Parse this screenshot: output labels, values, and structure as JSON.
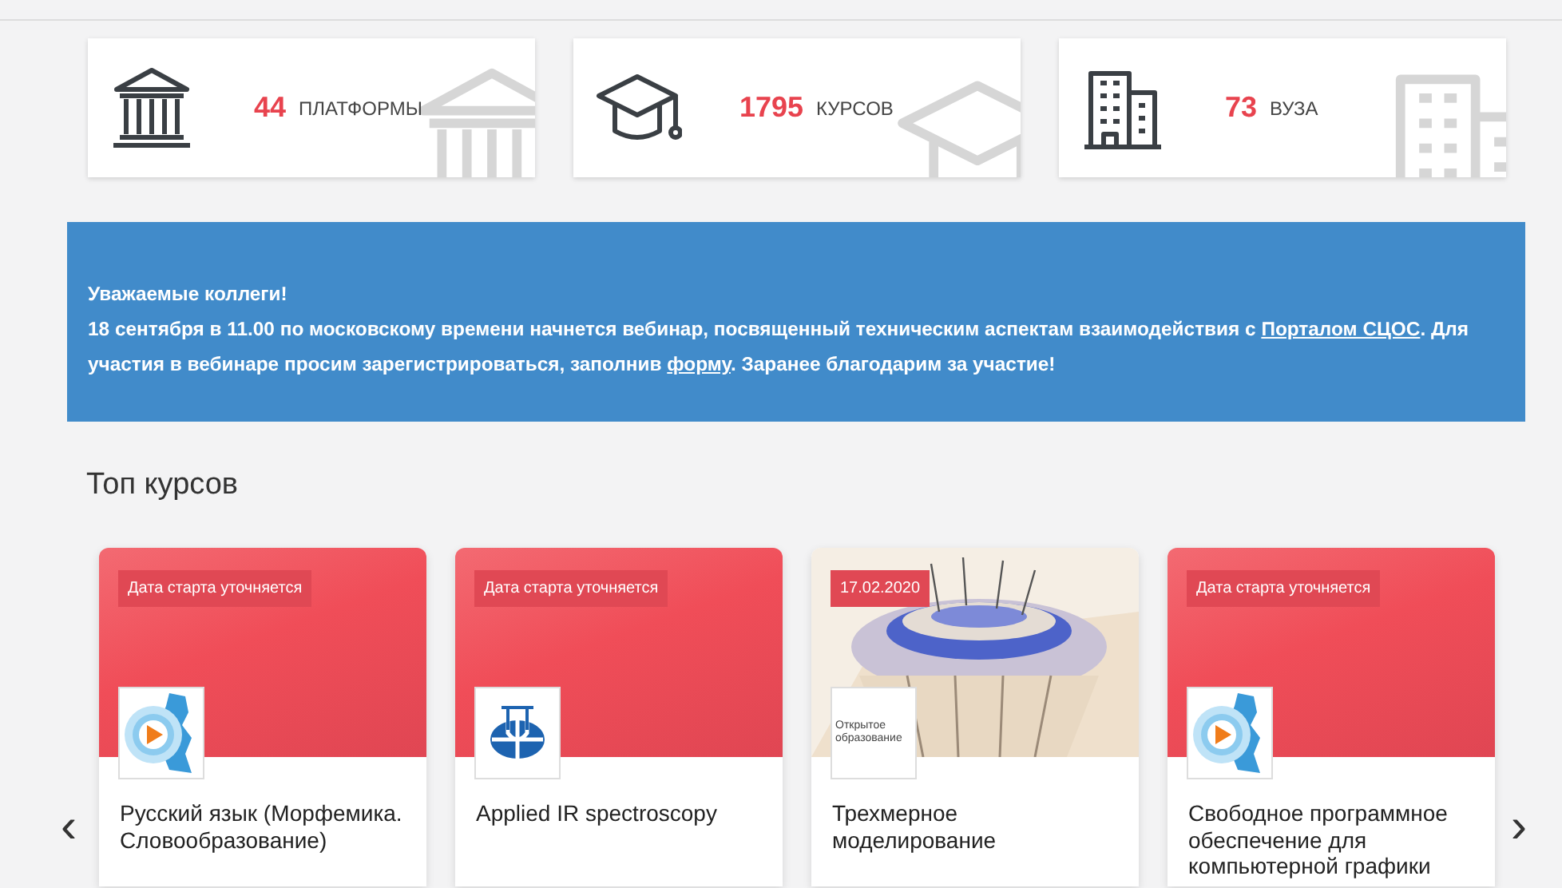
{
  "stats": [
    {
      "number": "44",
      "label": "ПЛАТФОРМЫ"
    },
    {
      "number": "1795",
      "label": "КУРСОВ"
    },
    {
      "number": "73",
      "label": "ВУЗА"
    }
  ],
  "notice": {
    "title": "Уважаемые коллеги!",
    "segments": [
      {
        "text": "18 сентября в 11.00 по московскому времени начнется вебинар, посвященный техническим аспектам взаимодействия с ",
        "link": false
      },
      {
        "text": "Порталом СЦОС",
        "link": true
      },
      {
        "text": ". Для участия в вебинаре просим зарегистрироваться, заполнив ",
        "link": false
      },
      {
        "text": "форму",
        "link": true
      },
      {
        "text": ". **Заранее благодарим за участие!**",
        "link": false
      }
    ]
  },
  "section_title": "Топ курсов",
  "carousel": {
    "prev": "‹",
    "next": "›"
  },
  "courses": [
    {
      "kind": "red",
      "badge": "Дата старта уточняется",
      "logo": {
        "kind": "map-play"
      },
      "title": [
        "Русский язык (Морфемика.",
        "Словообразование)"
      ]
    },
    {
      "kind": "red",
      "badge": "Дата старта уточняется",
      "logo": {
        "kind": "globe"
      },
      "title": [
        "Applied IR spectroscopy"
      ]
    },
    {
      "kind": "picture",
      "badge": "17.02.2020",
      "logo": {
        "kind": "text",
        "text": "Открытое образование"
      },
      "title": [
        "Трехмерное",
        "моделирование"
      ]
    },
    {
      "kind": "red",
      "badge": "Дата старта уточняется",
      "logo": {
        "kind": "map-play"
      },
      "title": [
        "Свободное программное",
        "обеспечение для",
        "компьютерной графики"
      ]
    }
  ]
}
